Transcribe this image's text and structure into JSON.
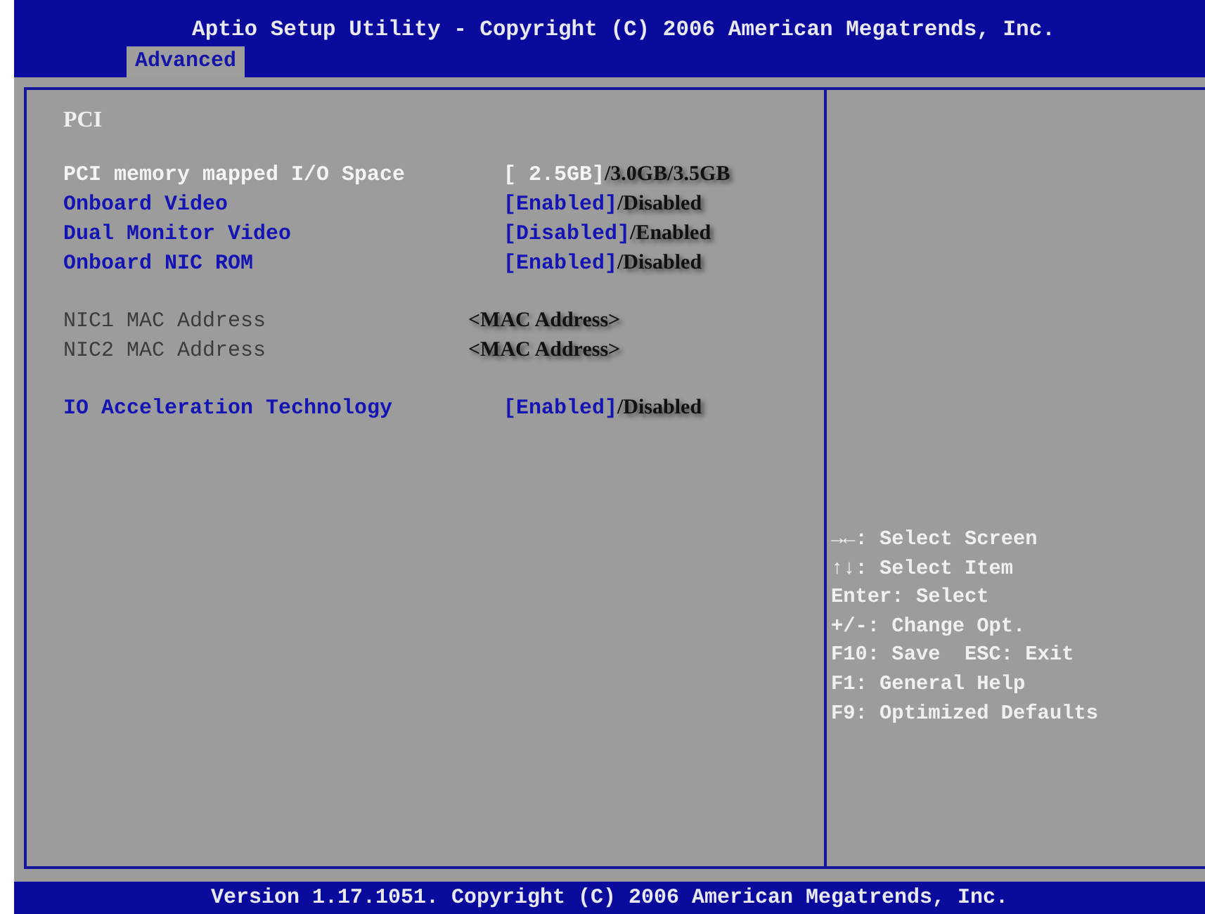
{
  "window": {
    "title": "Aptio Setup Utility - Copyright (C) 2006 American Megatrends, Inc."
  },
  "tabs": [
    {
      "label": "Advanced",
      "selected": true
    }
  ],
  "section": {
    "title": "PCI"
  },
  "groups": [
    [
      {
        "label": "PCI memory mapped I/O Space",
        "kind": "option",
        "selected": true,
        "current": "[ 2.5GB]",
        "others": "/3.0GB/3.5GB"
      },
      {
        "label": "Onboard Video",
        "kind": "option",
        "selected": false,
        "current": "[Enabled]",
        "others": "/Disabled"
      },
      {
        "label": "Dual Monitor Video",
        "kind": "option",
        "selected": false,
        "current": "[Disabled]",
        "others": "/Enabled"
      },
      {
        "label": "Onboard NIC ROM",
        "kind": "option",
        "selected": false,
        "current": "[Enabled]",
        "others": "/Disabled"
      }
    ],
    [
      {
        "label": "NIC1 MAC Address",
        "kind": "info",
        "selected": false,
        "others": "<MAC Address>"
      },
      {
        "label": "NIC2 MAC Address",
        "kind": "info",
        "selected": false,
        "others": "<MAC Address>"
      }
    ],
    [
      {
        "label": "IO Acceleration Technology",
        "kind": "option",
        "selected": false,
        "current": "[Enabled]",
        "others": "/Disabled"
      }
    ]
  ],
  "help": [
    "→←: Select Screen",
    "↑↓: Select Item",
    "Enter: Select",
    "+/-: Change Opt.",
    "F10: Save  ESC: Exit",
    "F1: General Help",
    "F9: Optimized Defaults"
  ],
  "status_bar": {
    "text": "Version 1.17.1051. Copyright (C) 2006 American Megatrends, Inc."
  }
}
